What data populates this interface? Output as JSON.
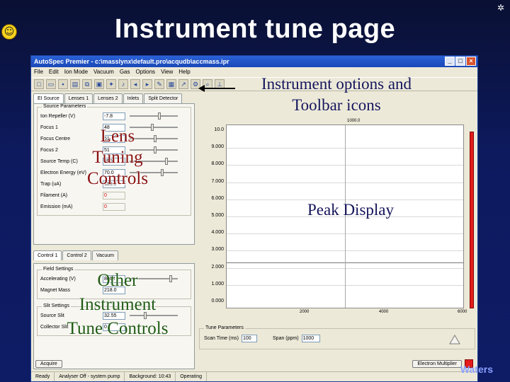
{
  "slide": {
    "title": "Instrument tune page",
    "corner_symbol": "✲",
    "footer": "Waters"
  },
  "app": {
    "window_title": "AutoSpec Premier - c:\\masslynx\\default.pro\\acqudb\\accmass.ipr",
    "window_buttons": [
      "_",
      "□",
      "×"
    ],
    "menu": [
      "File",
      "Edit",
      "Ion Mode",
      "Vacuum",
      "Gas",
      "Options",
      "View",
      "Help"
    ],
    "toolbar_icons": [
      "new-icon",
      "open-icon",
      "save-icon",
      "print-icon",
      "copy-icon",
      "paste-icon",
      "settings-icon",
      "music-icon",
      "arrow-left-icon",
      "arrow-right-icon",
      "tools-icon",
      "chart-icon",
      "trend-icon",
      "calibrate-icon",
      "zoom-icon",
      "graph-icon"
    ],
    "upper_tabs": [
      "EI Source",
      "Lenses 1",
      "Lenses 2",
      "Inlets",
      "Split Detector"
    ],
    "source_group_label": "Source Parameters",
    "source_params": [
      {
        "label": "Ion Repeller (V)",
        "value": "-7.8"
      },
      {
        "label": "Focus 1",
        "value": "48"
      },
      {
        "label": "Focus Centre",
        "value": "51"
      },
      {
        "label": "Focus 2",
        "value": "51"
      },
      {
        "label": "Source Temp (C)",
        "value": "250"
      },
      {
        "label": "Electron Energy (eV)",
        "value": "70.0"
      },
      {
        "label": "Trap (uA)",
        "value": "650.0"
      },
      {
        "label": "Filament (A)",
        "value": "0"
      },
      {
        "label": "Emission (mA)",
        "value": "0"
      }
    ],
    "lower_tabs": [
      "Control 1",
      "Control 2",
      "Vacuum"
    ],
    "field_settings_label": "Field Settings",
    "field_settings": [
      {
        "label": "Accelerating (V)",
        "value": "8000"
      },
      {
        "label": "Magnet Mass",
        "value": "218.0"
      }
    ],
    "slit_settings_label": "Slit Settings",
    "slit_settings": [
      {
        "label": "Source Slit",
        "value": "32.55"
      },
      {
        "label": "Collector Slit",
        "value": "0"
      }
    ],
    "peak_display": {
      "top_value": "1000.0",
      "y_ticks": [
        "10.0",
        "9.000",
        "8.000",
        "7.000",
        "6.000",
        "5.000",
        "4.000",
        "3.000",
        "2.000",
        "1.000",
        "0.000"
      ],
      "x_ticks": [
        "2000",
        "4000",
        "6000"
      ],
      "x_range": [
        0,
        6000
      ],
      "y_range": [
        0,
        10
      ],
      "chart_type": "line",
      "grid": true
    },
    "tune_params": {
      "group_label": "Tune Parameters",
      "scan_time_label": "Scan Time (ms)",
      "scan_time_value": "100",
      "span_label": "Span (ppm)",
      "span_value": "1000"
    },
    "buttons": {
      "left": "Acquire",
      "right": "Electron Multiplier"
    },
    "status": [
      "Ready",
      "Analyser Off - system pump",
      "Background: 10:43",
      "Operating"
    ]
  },
  "annotations": {
    "toolbar": [
      "Instrument options and",
      "Toolbar icons"
    ],
    "lens": [
      "Lens",
      "Tuning",
      "Controls"
    ],
    "peak": "Peak Display",
    "other": [
      "Other",
      "Instrument",
      "Tune Controls"
    ]
  },
  "colors": {
    "slide_bg": "#0e1c66",
    "title": "#ffffff",
    "annotation_green": "#1e5b12",
    "annotation_red": "#8a1212",
    "peak_bar": "#e31c1c"
  }
}
